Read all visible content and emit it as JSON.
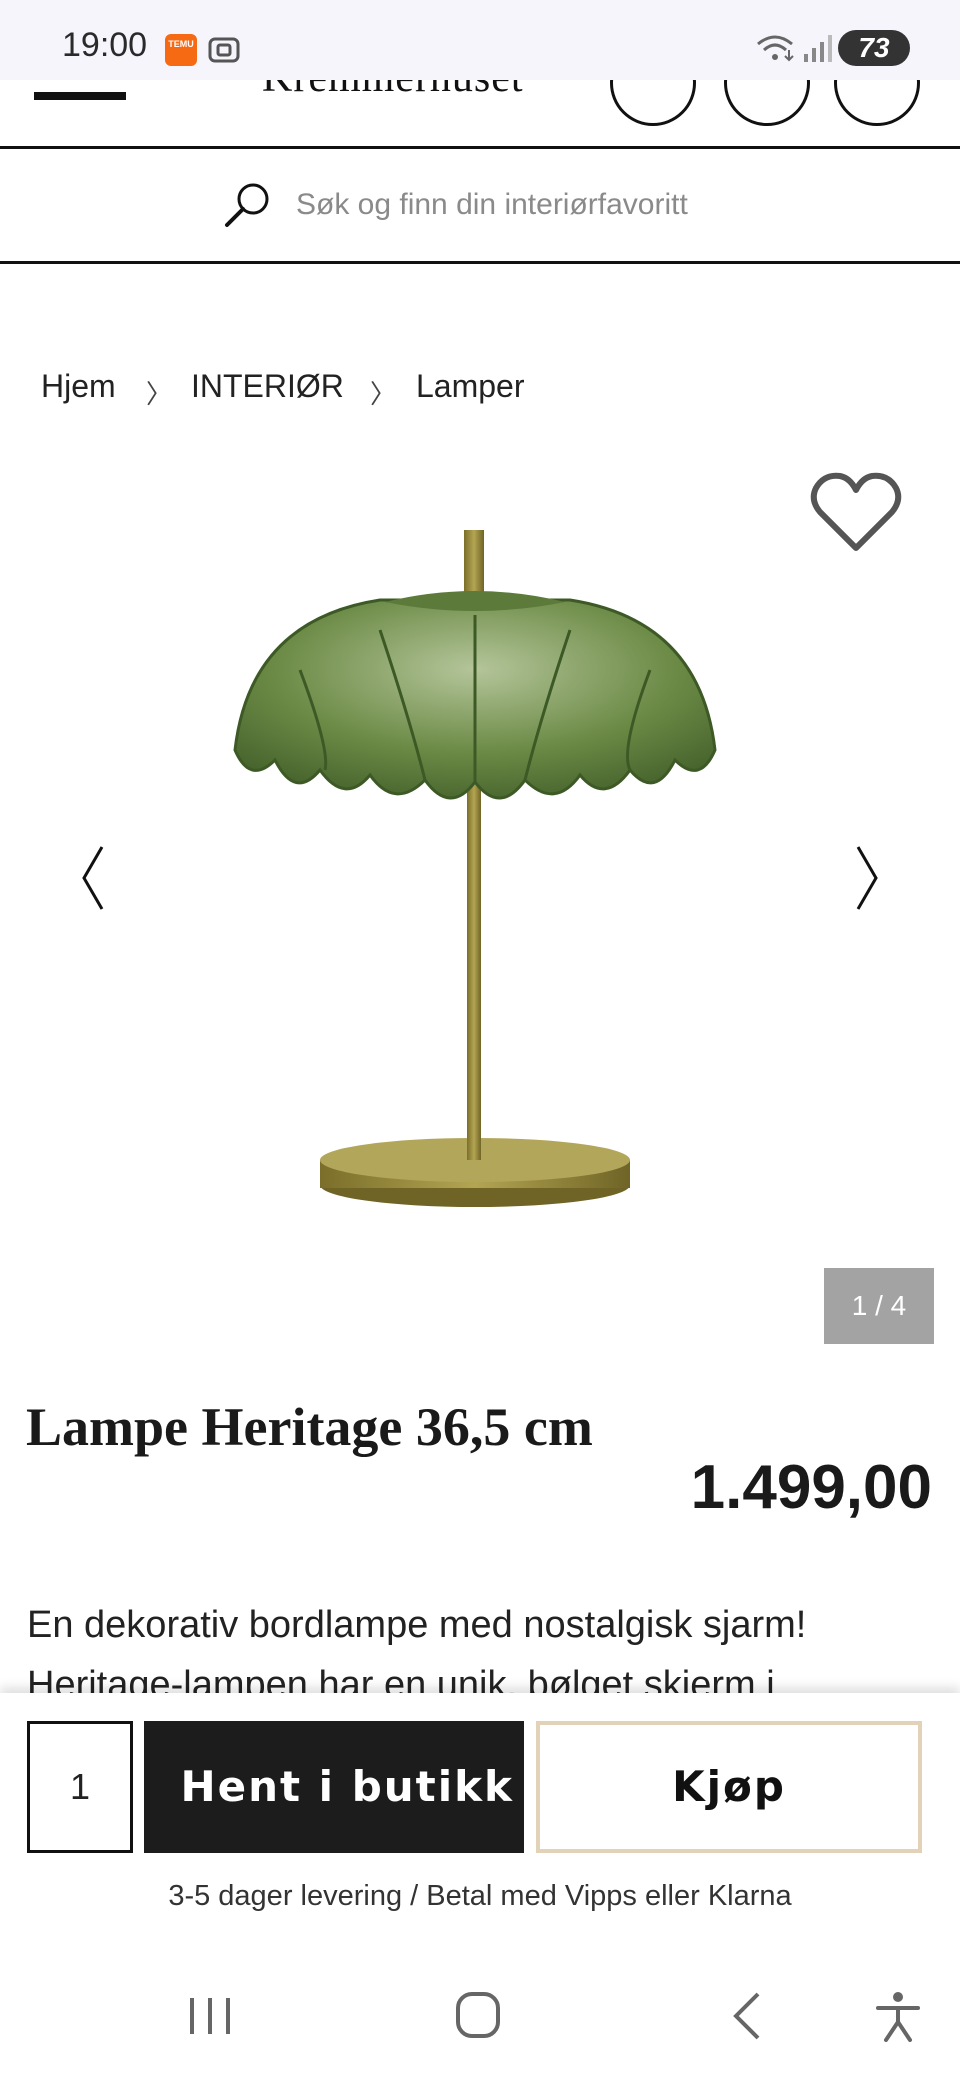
{
  "status_bar": {
    "time": "19:00",
    "temu_label": "TEMU",
    "battery": "73",
    "icons": [
      "temu-app-icon",
      "screenshot-icon",
      "wifi-icon",
      "signal-icon",
      "battery-icon"
    ]
  },
  "header": {
    "logo": "Kremmerhuset",
    "icons": [
      "menu-icon",
      "heart-icon",
      "account-icon",
      "cart-icon"
    ]
  },
  "search": {
    "placeholder": "Søk og finn din interiørfavoritt"
  },
  "breadcrumb": {
    "items": [
      "Hjem",
      "INTERIØR",
      "Lamper"
    ],
    "separator": "〉"
  },
  "gallery": {
    "counter": "1 / 4",
    "image_subject": "Green scalloped glass table lamp with brass stem and round base"
  },
  "product": {
    "title": "Lampe Heritage 36,5 cm",
    "price": "1.499,00",
    "description_line1": "En dekorativ bordlampe med nostalgisk sjarm!",
    "description_line2": "Heritage-lampen har en unik, bølget skjerm i"
  },
  "purchase": {
    "quantity": "1",
    "pickup_label": "Hent i butikk",
    "buy_label": "Kjøp",
    "delivery_info": "3-5 dager levering / Betal med Vipps eller Klarna"
  },
  "colors": {
    "primary_dark": "#1c1c1c",
    "buy_border": "#e2d3b8",
    "counter_bg": "#a3a3a3",
    "lamp_green": "#6b8a45",
    "lamp_brass": "#a59540"
  },
  "nav": {
    "icons": [
      "recent-apps-icon",
      "home-icon",
      "back-icon",
      "accessibility-icon"
    ]
  }
}
